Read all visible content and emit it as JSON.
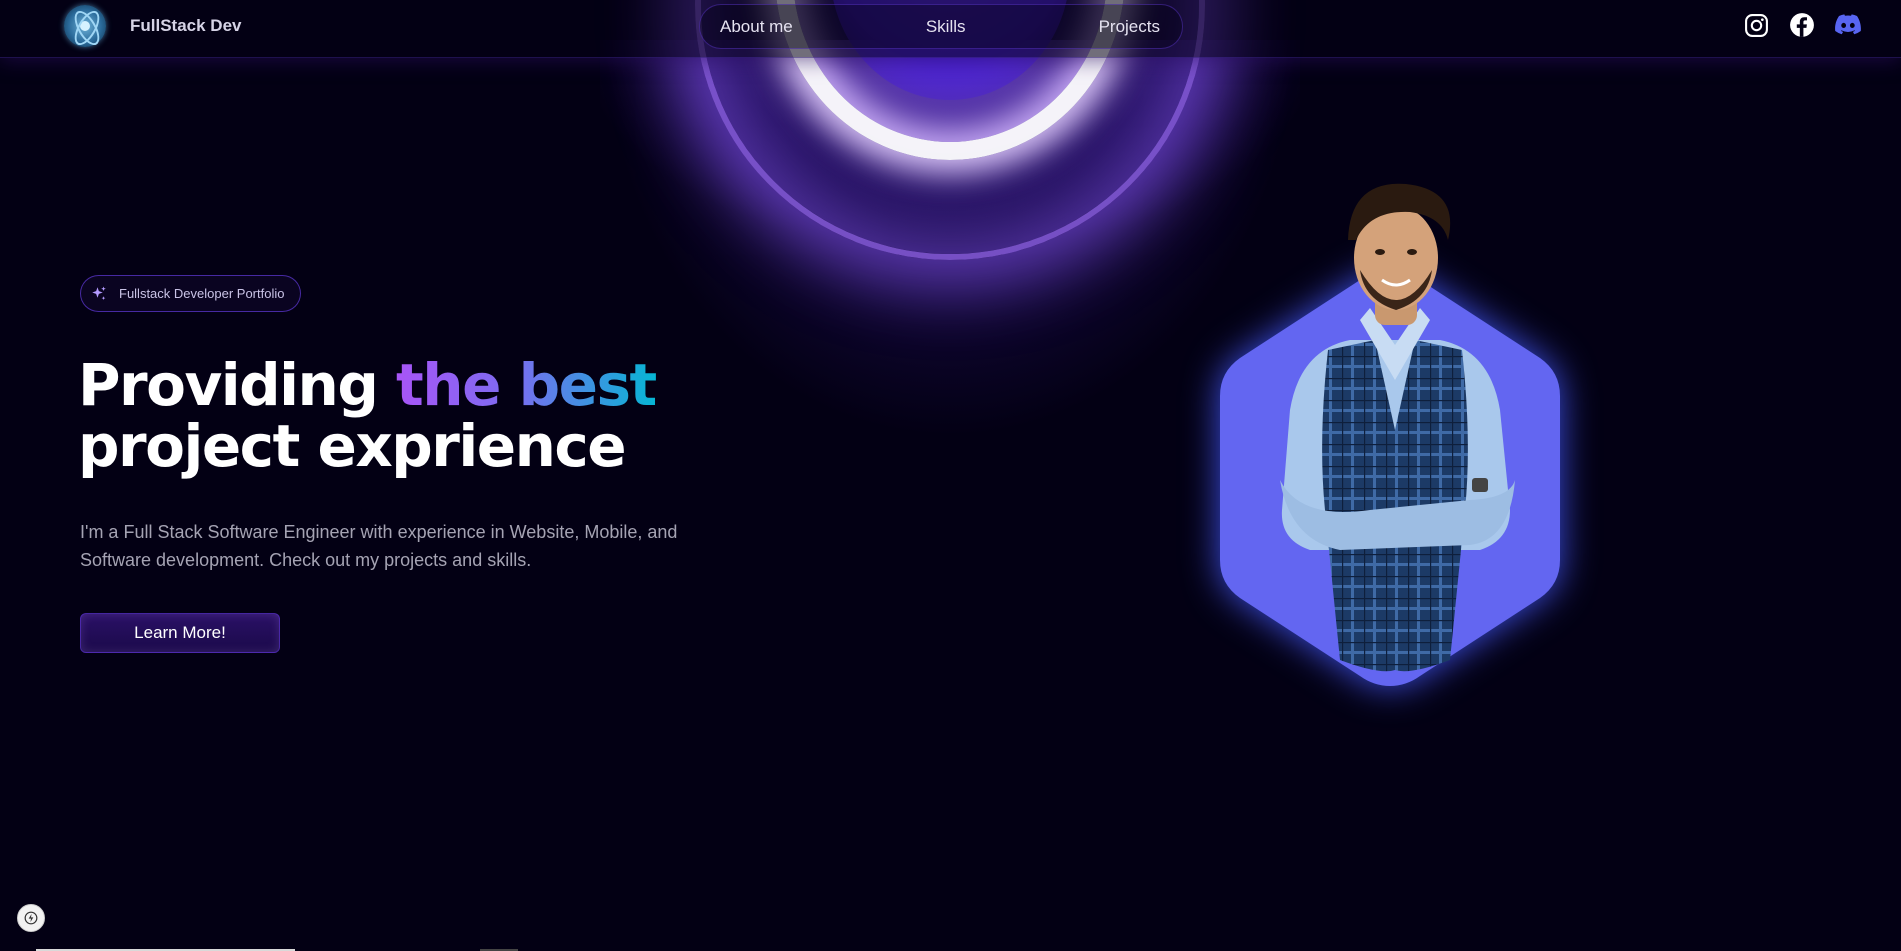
{
  "navbar": {
    "brand_name": "FullStack Dev",
    "links": [
      {
        "label": "About me"
      },
      {
        "label": "Skills"
      },
      {
        "label": "Projects"
      }
    ],
    "socials": [
      {
        "icon": "instagram-icon"
      },
      {
        "icon": "facebook-icon"
      },
      {
        "icon": "discord-icon"
      }
    ]
  },
  "hero": {
    "badge_text": "Fullstack Developer Portfolio",
    "headline_part1": "Providing ",
    "headline_highlight": "the best",
    "headline_part2": "project exprience",
    "description": "I'm a Full Stack Software Engineer with experience in Website, Mobile, and Software development. Check out my projects and skills.",
    "cta_label": "Learn More!"
  },
  "colors": {
    "background": "#030014",
    "accent": "#7042f8",
    "hexagon": "#6366f1",
    "gradient_start": "#a855f7",
    "gradient_end": "#06b6d4",
    "discord": "#5865f2"
  }
}
